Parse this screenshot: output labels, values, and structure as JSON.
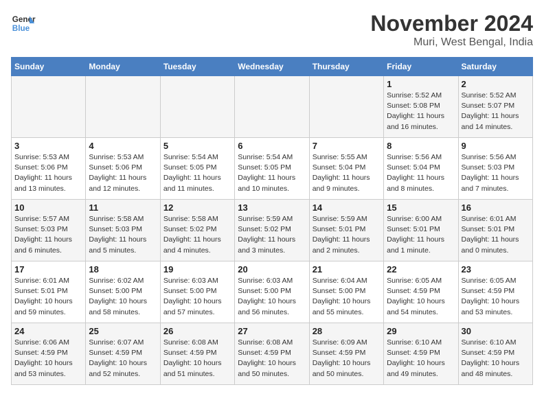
{
  "header": {
    "logo_line1": "General",
    "logo_line2": "Blue",
    "month": "November 2024",
    "location": "Muri, West Bengal, India"
  },
  "weekdays": [
    "Sunday",
    "Monday",
    "Tuesday",
    "Wednesday",
    "Thursday",
    "Friday",
    "Saturday"
  ],
  "weeks": [
    [
      {
        "day": "",
        "info": ""
      },
      {
        "day": "",
        "info": ""
      },
      {
        "day": "",
        "info": ""
      },
      {
        "day": "",
        "info": ""
      },
      {
        "day": "",
        "info": ""
      },
      {
        "day": "1",
        "info": "Sunrise: 5:52 AM\nSunset: 5:08 PM\nDaylight: 11 hours and 16 minutes."
      },
      {
        "day": "2",
        "info": "Sunrise: 5:52 AM\nSunset: 5:07 PM\nDaylight: 11 hours and 14 minutes."
      }
    ],
    [
      {
        "day": "3",
        "info": "Sunrise: 5:53 AM\nSunset: 5:06 PM\nDaylight: 11 hours and 13 minutes."
      },
      {
        "day": "4",
        "info": "Sunrise: 5:53 AM\nSunset: 5:06 PM\nDaylight: 11 hours and 12 minutes."
      },
      {
        "day": "5",
        "info": "Sunrise: 5:54 AM\nSunset: 5:05 PM\nDaylight: 11 hours and 11 minutes."
      },
      {
        "day": "6",
        "info": "Sunrise: 5:54 AM\nSunset: 5:05 PM\nDaylight: 11 hours and 10 minutes."
      },
      {
        "day": "7",
        "info": "Sunrise: 5:55 AM\nSunset: 5:04 PM\nDaylight: 11 hours and 9 minutes."
      },
      {
        "day": "8",
        "info": "Sunrise: 5:56 AM\nSunset: 5:04 PM\nDaylight: 11 hours and 8 minutes."
      },
      {
        "day": "9",
        "info": "Sunrise: 5:56 AM\nSunset: 5:03 PM\nDaylight: 11 hours and 7 minutes."
      }
    ],
    [
      {
        "day": "10",
        "info": "Sunrise: 5:57 AM\nSunset: 5:03 PM\nDaylight: 11 hours and 6 minutes."
      },
      {
        "day": "11",
        "info": "Sunrise: 5:58 AM\nSunset: 5:03 PM\nDaylight: 11 hours and 5 minutes."
      },
      {
        "day": "12",
        "info": "Sunrise: 5:58 AM\nSunset: 5:02 PM\nDaylight: 11 hours and 4 minutes."
      },
      {
        "day": "13",
        "info": "Sunrise: 5:59 AM\nSunset: 5:02 PM\nDaylight: 11 hours and 3 minutes."
      },
      {
        "day": "14",
        "info": "Sunrise: 5:59 AM\nSunset: 5:01 PM\nDaylight: 11 hours and 2 minutes."
      },
      {
        "day": "15",
        "info": "Sunrise: 6:00 AM\nSunset: 5:01 PM\nDaylight: 11 hours and 1 minute."
      },
      {
        "day": "16",
        "info": "Sunrise: 6:01 AM\nSunset: 5:01 PM\nDaylight: 11 hours and 0 minutes."
      }
    ],
    [
      {
        "day": "17",
        "info": "Sunrise: 6:01 AM\nSunset: 5:01 PM\nDaylight: 10 hours and 59 minutes."
      },
      {
        "day": "18",
        "info": "Sunrise: 6:02 AM\nSunset: 5:00 PM\nDaylight: 10 hours and 58 minutes."
      },
      {
        "day": "19",
        "info": "Sunrise: 6:03 AM\nSunset: 5:00 PM\nDaylight: 10 hours and 57 minutes."
      },
      {
        "day": "20",
        "info": "Sunrise: 6:03 AM\nSunset: 5:00 PM\nDaylight: 10 hours and 56 minutes."
      },
      {
        "day": "21",
        "info": "Sunrise: 6:04 AM\nSunset: 5:00 PM\nDaylight: 10 hours and 55 minutes."
      },
      {
        "day": "22",
        "info": "Sunrise: 6:05 AM\nSunset: 4:59 PM\nDaylight: 10 hours and 54 minutes."
      },
      {
        "day": "23",
        "info": "Sunrise: 6:05 AM\nSunset: 4:59 PM\nDaylight: 10 hours and 53 minutes."
      }
    ],
    [
      {
        "day": "24",
        "info": "Sunrise: 6:06 AM\nSunset: 4:59 PM\nDaylight: 10 hours and 53 minutes."
      },
      {
        "day": "25",
        "info": "Sunrise: 6:07 AM\nSunset: 4:59 PM\nDaylight: 10 hours and 52 minutes."
      },
      {
        "day": "26",
        "info": "Sunrise: 6:08 AM\nSunset: 4:59 PM\nDaylight: 10 hours and 51 minutes."
      },
      {
        "day": "27",
        "info": "Sunrise: 6:08 AM\nSunset: 4:59 PM\nDaylight: 10 hours and 50 minutes."
      },
      {
        "day": "28",
        "info": "Sunrise: 6:09 AM\nSunset: 4:59 PM\nDaylight: 10 hours and 50 minutes."
      },
      {
        "day": "29",
        "info": "Sunrise: 6:10 AM\nSunset: 4:59 PM\nDaylight: 10 hours and 49 minutes."
      },
      {
        "day": "30",
        "info": "Sunrise: 6:10 AM\nSunset: 4:59 PM\nDaylight: 10 hours and 48 minutes."
      }
    ]
  ]
}
